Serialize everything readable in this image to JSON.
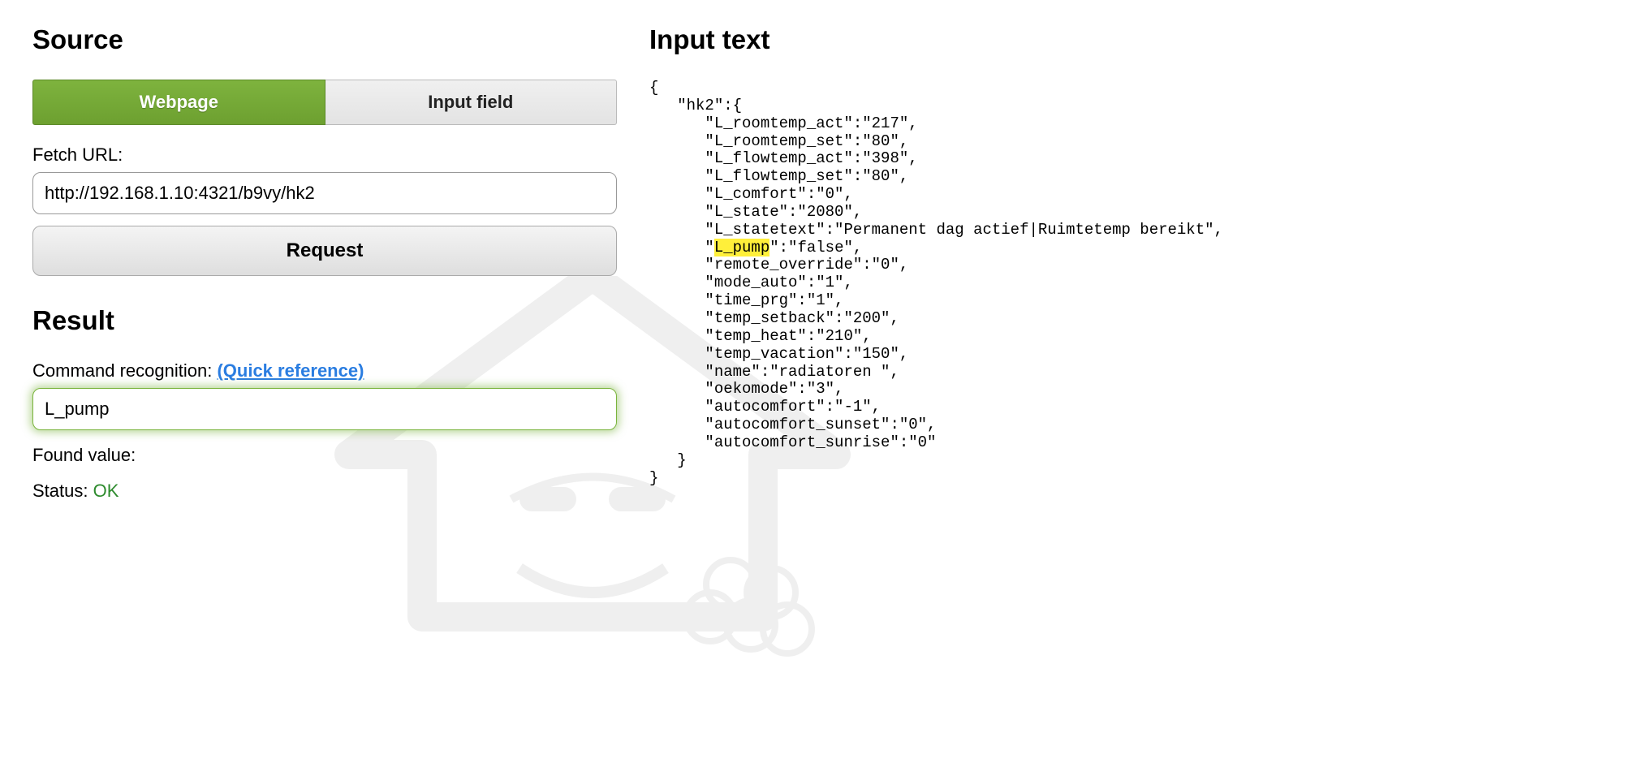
{
  "source": {
    "heading": "Source",
    "tabs": {
      "webpage": "Webpage",
      "input_field": "Input field"
    },
    "fetch_label": "Fetch URL:",
    "fetch_value": "http://192.168.1.10:4321/b9vy/hk2",
    "request_button": "Request"
  },
  "result": {
    "heading": "Result",
    "cmd_label": "Command recognition: ",
    "quick_ref": "(Quick reference)",
    "cmd_value": "L_pump",
    "found_label": "Found value:",
    "status_label": "Status: ",
    "status_value": "OK"
  },
  "input_text": {
    "heading": "Input text",
    "json": {
      "hk2": {
        "L_roomtemp_act": "217",
        "L_roomtemp_set": "80",
        "L_flowtemp_act": "398",
        "L_flowtemp_set": "80",
        "L_comfort": "0",
        "L_state": "2080",
        "L_statetext": "Permanent dag actief|Ruimtetemp bereikt",
        "L_pump": "false",
        "remote_override": "0",
        "mode_auto": "1",
        "time_prg": "1",
        "temp_setback": "200",
        "temp_heat": "210",
        "temp_vacation": "150",
        "name": "radiatoren ",
        "oekomode": "3",
        "autocomfort": "-1",
        "autocomfort_sunset": "0",
        "autocomfort_sunrise": "0"
      }
    },
    "highlight_key": "L_pump"
  }
}
